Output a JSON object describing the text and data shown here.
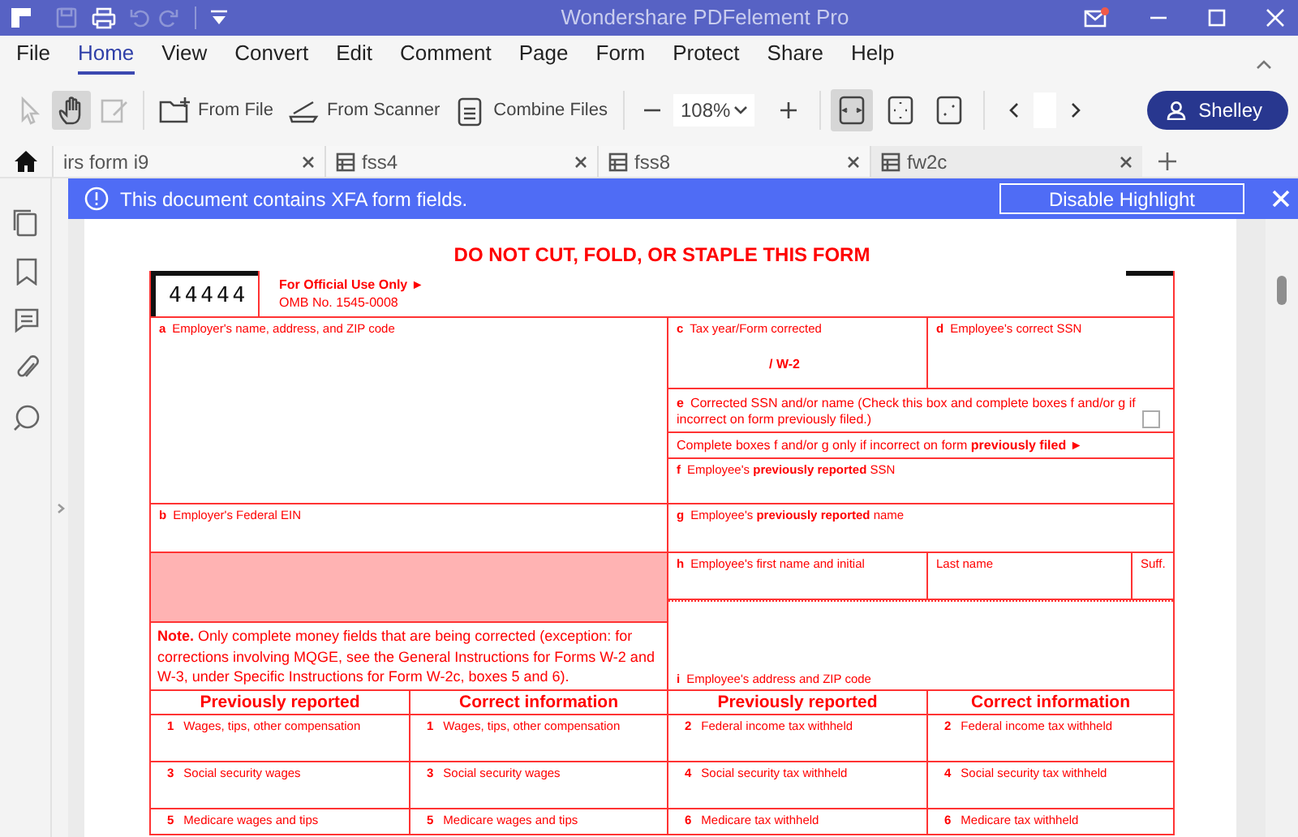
{
  "window": {
    "title": "Wondershare PDFelement Pro"
  },
  "menu": [
    {
      "label": "File",
      "selected": false
    },
    {
      "label": "Home",
      "selected": true
    },
    {
      "label": "View",
      "selected": false
    },
    {
      "label": "Convert",
      "selected": false
    },
    {
      "label": "Edit",
      "selected": false
    },
    {
      "label": "Comment",
      "selected": false
    },
    {
      "label": "Page",
      "selected": false
    },
    {
      "label": "Form",
      "selected": false
    },
    {
      "label": "Protect",
      "selected": false
    },
    {
      "label": "Share",
      "selected": false
    },
    {
      "label": "Help",
      "selected": false
    }
  ],
  "toolbar": {
    "modes": [
      {
        "kind": "select",
        "selected": false,
        "disabled": true
      },
      {
        "kind": "hand",
        "selected": true,
        "disabled": false
      },
      {
        "kind": "edit",
        "selected": false,
        "disabled": true
      }
    ],
    "actions": [
      {
        "kind": "file",
        "label": "From File"
      },
      {
        "kind": "scanner",
        "label": "From Scanner"
      },
      {
        "kind": "combine",
        "label": "Combine Files"
      }
    ],
    "zoom": "108%",
    "views": [
      {
        "kind": "fit-width",
        "selected": true
      },
      {
        "kind": "fit-page",
        "selected": false
      },
      {
        "kind": "actual",
        "selected": false
      }
    ],
    "user": "Shelley"
  },
  "tabs": [
    {
      "label": "irs form i9",
      "kind": "plain",
      "selected": false
    },
    {
      "label": "fss4",
      "kind": "document",
      "selected": false
    },
    {
      "label": "fss8",
      "kind": "document",
      "selected": false
    },
    {
      "label": "fw2c",
      "kind": "document",
      "selected": true
    }
  ],
  "banner": {
    "message": "This document contains XFA form fields.",
    "button": "Disable Highlight"
  },
  "form": {
    "title": "DO NOT CUT, FOLD, OR STAPLE THIS FORM",
    "code": "44444",
    "official_use": "For Official Use Only ►",
    "omb": "OMB No. 1545-0008",
    "a": {
      "letter": "a",
      "label": "Employer's name, address, and ZIP code"
    },
    "b": {
      "letter": "b",
      "label": "Employer's Federal EIN"
    },
    "c": {
      "letter": "c",
      "label": "Tax year/Form corrected",
      "value": "/ W-2"
    },
    "d": {
      "letter": "d",
      "label": "Employee's correct SSN"
    },
    "e": {
      "letter": "e",
      "label": "Corrected SSN and/or name (Check this box and complete boxes f and/or g if incorrect on form previously filed.)",
      "checked": false
    },
    "notice": "Complete boxes f and/or g only if incorrect on form **previously filed** ►",
    "f": {
      "letter": "f",
      "label": "Employee's **previously reported** SSN"
    },
    "g": {
      "letter": "g",
      "label": "Employee's **previously reported** name"
    },
    "h": {
      "letter": "h",
      "label": "Employee's first name and initial"
    },
    "last_name": "Last name",
    "suffix": "Suff.",
    "i": {
      "letter": "i",
      "label": "Employee's address and ZIP code"
    },
    "note": "**Note.** Only complete money fields that are being corrected (exception: for corrections involving MQGE, see the General Instructions for Forms W-2 and W-3, under Specific Instructions for Form W-2c, boxes 5 and 6).",
    "money_headers": [
      "Previously reported",
      "Correct information",
      "Previously reported",
      "Correct information"
    ],
    "money_rows": [
      [
        {
          "number": "1",
          "label": "Wages, tips, other compensation"
        },
        {
          "number": "1",
          "label": "Wages, tips, other compensation"
        },
        {
          "number": "2",
          "label": "Federal income tax withheld"
        },
        {
          "number": "2",
          "label": "Federal income tax withheld"
        }
      ],
      [
        {
          "number": "3",
          "label": "Social security wages"
        },
        {
          "number": "3",
          "label": "Social security wages"
        },
        {
          "number": "4",
          "label": "Social security tax withheld"
        },
        {
          "number": "4",
          "label": "Social security tax withheld"
        }
      ],
      [
        {
          "number": "5",
          "label": "Medicare wages and tips"
        },
        {
          "number": "5",
          "label": "Medicare wages and tips"
        },
        {
          "number": "6",
          "label": "Medicare tax withheld"
        },
        {
          "number": "6",
          "label": "Medicare tax withheld"
        }
      ]
    ]
  }
}
